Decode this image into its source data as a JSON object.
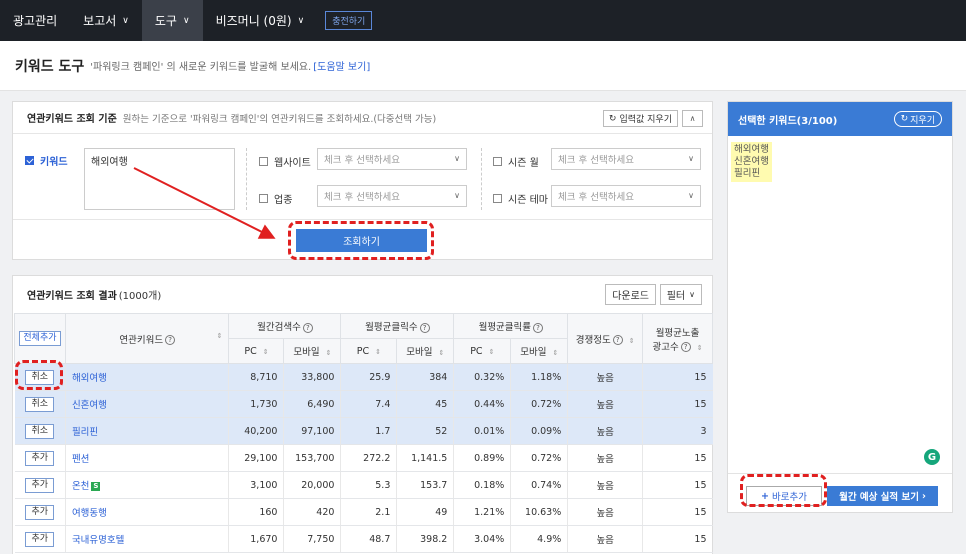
{
  "topnav": {
    "items": [
      {
        "label": "광고관리",
        "chevron": false
      },
      {
        "label": "보고서",
        "chevron": true
      },
      {
        "label": "도구",
        "chevron": true
      },
      {
        "label": "비즈머니 (0원)",
        "chevron": true
      }
    ],
    "active_index": 2,
    "charge_label": "충전하기"
  },
  "page": {
    "title": "키워드 도구",
    "description": "'파워링크 캠페인' 의 새로운 키워드를 발굴해 보세요.",
    "help_link": "[도움말 보기]"
  },
  "query": {
    "header": "연관키워드 조회 기준",
    "subtext": "원하는 기준으로 '파워링크 캠페인'의 연관키워드를 조회하세요.(다중선택 가능)",
    "reset_label": "입력값 지우기",
    "keyword_label": "키워드",
    "keyword_value": "해외여행",
    "website_label": "웹사이트",
    "industry_label": "업종",
    "season_month_label": "시즌 월",
    "season_theme_label": "시즌 테마",
    "select_placeholder": "체크 후 선택하세요",
    "search_label": "조회하기"
  },
  "results": {
    "header": "연관키워드 조회 결과",
    "count": "(1000개)",
    "download_label": "다운로드",
    "filter_label": "필터",
    "add_all_label": "전체추가",
    "columns": {
      "keyword": "연관키워드",
      "monthly_search": "월간검색수",
      "monthly_clicks": "월평균클릭수",
      "monthly_ctr": "월평균클릭률",
      "competition": "경쟁정도",
      "ad_count_line1": "월평균노출",
      "ad_count_line2": "광고수",
      "pc": "PC",
      "mobile": "모바일"
    },
    "rows": [
      {
        "action": "취소",
        "selected": true,
        "keyword": "해외여행",
        "badge": "",
        "search_pc": "8,710",
        "search_mobile": "33,800",
        "clicks_pc": "25.9",
        "clicks_mobile": "384",
        "ctr_pc": "0.32%",
        "ctr_mobile": "1.18%",
        "competition": "높음",
        "ads": "15"
      },
      {
        "action": "취소",
        "selected": true,
        "keyword": "신혼여행",
        "badge": "",
        "search_pc": "1,730",
        "search_mobile": "6,490",
        "clicks_pc": "7.4",
        "clicks_mobile": "45",
        "ctr_pc": "0.44%",
        "ctr_mobile": "0.72%",
        "competition": "높음",
        "ads": "15"
      },
      {
        "action": "취소",
        "selected": true,
        "keyword": "필리핀",
        "badge": "",
        "search_pc": "40,200",
        "search_mobile": "97,100",
        "clicks_pc": "1.7",
        "clicks_mobile": "52",
        "ctr_pc": "0.01%",
        "ctr_mobile": "0.09%",
        "competition": "높음",
        "ads": "3"
      },
      {
        "action": "추가",
        "selected": false,
        "keyword": "펜션",
        "badge": "",
        "search_pc": "29,100",
        "search_mobile": "153,700",
        "clicks_pc": "272.2",
        "clicks_mobile": "1,141.5",
        "ctr_pc": "0.89%",
        "ctr_mobile": "0.72%",
        "competition": "높음",
        "ads": "15"
      },
      {
        "action": "추가",
        "selected": false,
        "keyword": "온천",
        "badge": "S",
        "search_pc": "3,100",
        "search_mobile": "20,000",
        "clicks_pc": "5.3",
        "clicks_mobile": "153.7",
        "ctr_pc": "0.18%",
        "ctr_mobile": "0.74%",
        "competition": "높음",
        "ads": "15"
      },
      {
        "action": "추가",
        "selected": false,
        "keyword": "여행동행",
        "badge": "",
        "search_pc": "160",
        "search_mobile": "420",
        "clicks_pc": "2.1",
        "clicks_mobile": "49",
        "ctr_pc": "1.21%",
        "ctr_mobile": "10.63%",
        "competition": "높음",
        "ads": "15"
      },
      {
        "action": "추가",
        "selected": false,
        "keyword": "국내유명호텔",
        "badge": "",
        "search_pc": "1,670",
        "search_mobile": "7,750",
        "clicks_pc": "48.7",
        "clicks_mobile": "398.2",
        "ctr_pc": "3.04%",
        "ctr_mobile": "4.9%",
        "competition": "높음",
        "ads": "15"
      }
    ]
  },
  "selected_panel": {
    "header": "선택한 키워드(3/100)",
    "clear_label": "지우기",
    "keywords": [
      "해외여행",
      "신혼여행",
      "필리핀"
    ],
    "quick_add_label": "바로추가",
    "forecast_label": "월간 예상 실적 보기"
  },
  "colors": {
    "accent": "#3a7bd5",
    "nav_bg": "#1d2127",
    "selected_row": "#dde8f8",
    "annotation": "#e02020"
  }
}
